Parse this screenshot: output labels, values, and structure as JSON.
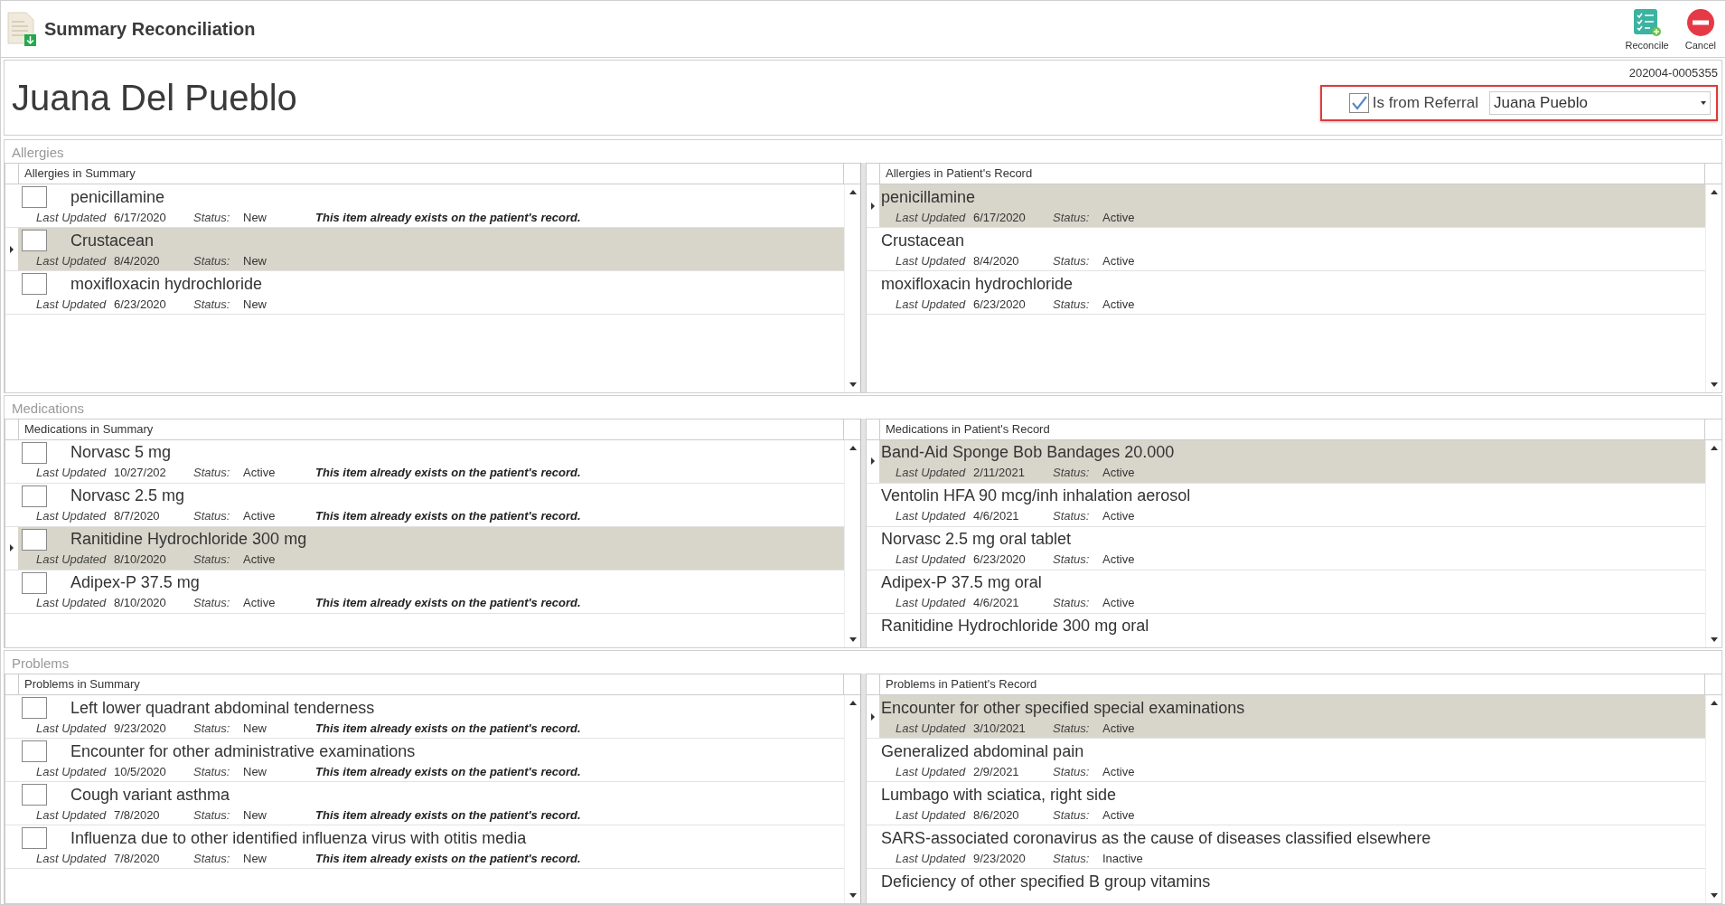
{
  "window": {
    "title": "Summary Reconciliation"
  },
  "toolbar": [
    {
      "label": "Reconcile",
      "kind": "reconcile"
    },
    {
      "label": "Cancel",
      "kind": "cancel"
    }
  ],
  "patient": {
    "name": "Juana Del Pueblo",
    "id": "202004-0005355"
  },
  "referral": {
    "label": "Is from Referral",
    "checked": true,
    "value": "Juana  Pueblo"
  },
  "sections": [
    {
      "title": "Allergies",
      "summary": {
        "heading": "Allergies in Summary",
        "items": [
          {
            "name": "penicillamine",
            "updated_label": "Last Updated",
            "updated": "6/17/2020",
            "status_label": "Status:",
            "status": "New",
            "note": "This item already exists on the patient's record.",
            "checked": false,
            "selected": false
          },
          {
            "name": "Crustacean",
            "updated_label": "Last Updated",
            "updated": "8/4/2020",
            "status_label": "Status:",
            "status": "New",
            "checked": false,
            "selected": true
          },
          {
            "name": "moxifloxacin hydrochloride",
            "updated_label": "Last Updated",
            "updated": "6/23/2020",
            "status_label": "Status:",
            "status": "New",
            "checked": false,
            "selected": false
          }
        ]
      },
      "record": {
        "heading": "Allergies in Patient's Record",
        "items": [
          {
            "name": "penicillamine",
            "updated_label": "Last Updated",
            "updated": "6/17/2020",
            "status_label": "Status:",
            "status": "Active",
            "selected": true
          },
          {
            "name": "Crustacean",
            "updated_label": "Last Updated",
            "updated": "8/4/2020",
            "status_label": "Status:",
            "status": "Active",
            "selected": false
          },
          {
            "name": "moxifloxacin hydrochloride",
            "updated_label": "Last Updated",
            "updated": "6/23/2020",
            "status_label": "Status:",
            "status": "Active",
            "selected": false
          }
        ]
      }
    },
    {
      "title": "Medications",
      "summary": {
        "heading": "Medications in Summary",
        "items": [
          {
            "name": "Norvasc 5 mg",
            "updated_label": "Last Updated",
            "updated": "10/27/202",
            "status_label": "Status:",
            "status": "Active",
            "note": "This item already exists on the patient's record.",
            "checked": false,
            "selected": false
          },
          {
            "name": "Norvasc 2.5 mg",
            "updated_label": "Last Updated",
            "updated": "8/7/2020",
            "status_label": "Status:",
            "status": "Active",
            "note": "This item already exists on the patient's record.",
            "checked": false,
            "selected": false
          },
          {
            "name": "Ranitidine Hydrochloride 300 mg",
            "updated_label": "Last Updated",
            "updated": "8/10/2020",
            "status_label": "Status:",
            "status": "Active",
            "checked": false,
            "selected": true
          },
          {
            "name": "Adipex-P 37.5 mg",
            "updated_label": "Last Updated",
            "updated": "8/10/2020",
            "status_label": "Status:",
            "status": "Active",
            "note": "This item already exists on the patient's record.",
            "checked": false,
            "selected": false
          }
        ]
      },
      "record": {
        "heading": "Medications in Patient's Record",
        "items": [
          {
            "name": "Band-Aid Sponge Bob Bandages 20.000",
            "updated_label": "Last Updated",
            "updated": "2/11/2021",
            "status_label": "Status:",
            "status": "Active",
            "selected": true
          },
          {
            "name": "Ventolin HFA 90 mcg/inh inhalation aerosol",
            "updated_label": "Last Updated",
            "updated": "4/6/2021",
            "status_label": "Status:",
            "status": "Active",
            "selected": false
          },
          {
            "name": "Norvasc 2.5 mg oral tablet",
            "updated_label": "Last Updated",
            "updated": "6/23/2020",
            "status_label": "Status:",
            "status": "Active",
            "selected": false
          },
          {
            "name": "Adipex-P 37.5 mg oral",
            "updated_label": "Last Updated",
            "updated": "4/6/2021",
            "status_label": "Status:",
            "status": "Active",
            "selected": false
          },
          {
            "name": "Ranitidine Hydrochloride 300 mg oral",
            "selected": false
          }
        ]
      }
    },
    {
      "title": "Problems",
      "summary": {
        "heading": "Problems in Summary",
        "items": [
          {
            "name": "Left lower quadrant abdominal tenderness",
            "updated_label": "Last Updated",
            "updated": "9/23/2020",
            "status_label": "Status:",
            "status": "New",
            "note": "This item already exists on the patient's record.",
            "checked": false,
            "selected": false
          },
          {
            "name": "Encounter for other administrative examinations",
            "updated_label": "Last Updated",
            "updated": "10/5/2020",
            "status_label": "Status:",
            "status": "New",
            "note": "This item already exists on the patient's record.",
            "checked": false,
            "selected": false
          },
          {
            "name": "Cough variant asthma",
            "updated_label": "Last Updated",
            "updated": "7/8/2020",
            "status_label": "Status:",
            "status": "New",
            "note": "This item already exists on the patient's record.",
            "checked": false,
            "selected": false
          },
          {
            "name": "Influenza due to other identified influenza virus with otitis media",
            "updated_label": "Last Updated",
            "updated": "7/8/2020",
            "status_label": "Status:",
            "status": "New",
            "note": "This item already exists on the patient's record.",
            "checked": false,
            "selected": false
          }
        ]
      },
      "record": {
        "heading": "Problems in Patient's Record",
        "items": [
          {
            "name": "Encounter for other specified special examinations",
            "updated_label": "Last Updated",
            "updated": "3/10/2021",
            "status_label": "Status:",
            "status": "Active",
            "selected": true
          },
          {
            "name": "Generalized abdominal pain",
            "updated_label": "Last Updated",
            "updated": "2/9/2021",
            "status_label": "Status:",
            "status": "Active",
            "selected": false
          },
          {
            "name": "Lumbago with sciatica, right side",
            "updated_label": "Last Updated",
            "updated": "8/6/2020",
            "status_label": "Status:",
            "status": "Active",
            "selected": false
          },
          {
            "name": "SARS-associated coronavirus as the cause of diseases classified elsewhere",
            "updated_label": "Last Updated",
            "updated": "9/23/2020",
            "status_label": "Status:",
            "status": "Inactive",
            "selected": false
          },
          {
            "name": "Deficiency of other specified B group vitamins",
            "selected": false
          }
        ]
      }
    }
  ]
}
